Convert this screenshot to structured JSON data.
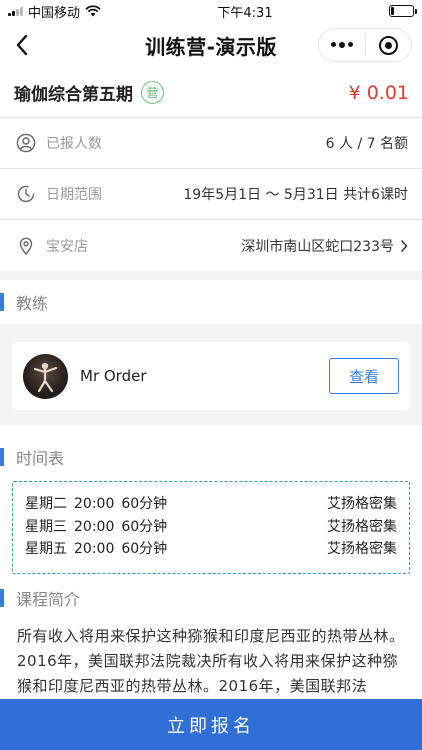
{
  "status_bar": {
    "carrier": "中国移动",
    "time": "下午4:31",
    "battery_level": 0.15
  },
  "nav": {
    "title": "训练营-演示版",
    "icons": [
      "back-icon",
      "more-icon",
      "close-target-icon"
    ]
  },
  "course": {
    "name": "瑜伽综合第五期",
    "badge": "营",
    "price": "¥ 0.01"
  },
  "info": {
    "enrolled_label": "已报人数",
    "enrolled_value": "6 人 / 7 名额",
    "date_label": "日期范围",
    "date_value": "19年5月1日 ～ 5月31日 共计6课时",
    "store_label": "宝安店",
    "store_address": "深圳市南山区蛇口233号"
  },
  "coach_section": {
    "title": "教练",
    "coach_name": "Mr Order",
    "view_button": "查看"
  },
  "schedule_section": {
    "title": "时间表",
    "rows": [
      {
        "day": "星期二",
        "time": "20:00",
        "duration": "60分钟",
        "location": "艾扬格密集"
      },
      {
        "day": "星期三",
        "time": "20:00",
        "duration": "60分钟",
        "location": "艾扬格密集"
      },
      {
        "day": "星期五",
        "time": "20:00",
        "duration": "60分钟",
        "location": "艾扬格密集"
      }
    ]
  },
  "intro_section": {
    "title": "课程简介",
    "text": "所有收入将用来保护这种猕猴和印度尼西亚的热带丛林。2016年，美国联邦法院裁决所有收入将用来保护这种猕猴和印度尼西亚的热带丛林。2016年，美国联邦法"
  },
  "signup_button": "立即报名",
  "colors": {
    "accent_blue": "#2f6fd6",
    "price_red": "#e03c2f",
    "badge_green": "#4fb36a",
    "schedule_border": "#3a9ca0"
  }
}
